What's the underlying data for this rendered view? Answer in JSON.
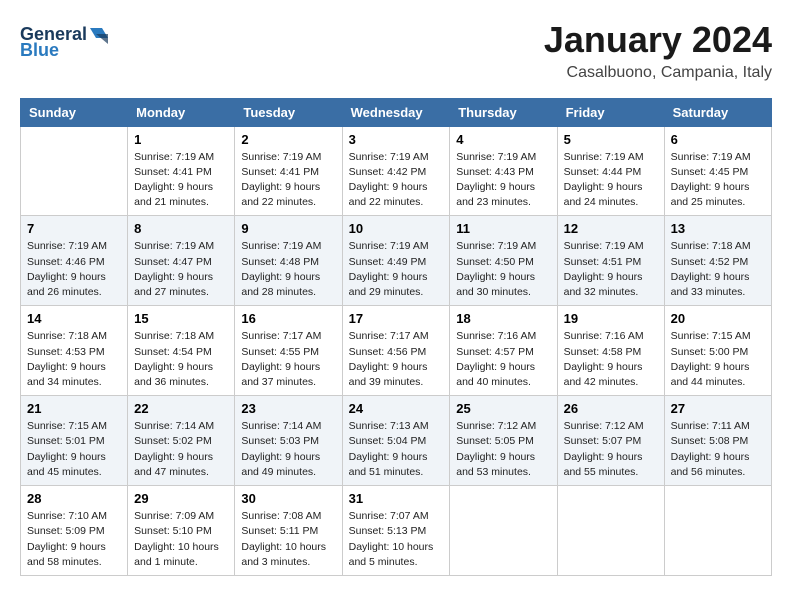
{
  "header": {
    "logo_line1": "General",
    "logo_line2": "Blue",
    "month_title": "January 2024",
    "location": "Casalbuono, Campania, Italy"
  },
  "days_of_week": [
    "Sunday",
    "Monday",
    "Tuesday",
    "Wednesday",
    "Thursday",
    "Friday",
    "Saturday"
  ],
  "weeks": [
    [
      {
        "day": "",
        "info": ""
      },
      {
        "day": "1",
        "info": "Sunrise: 7:19 AM\nSunset: 4:41 PM\nDaylight: 9 hours\nand 21 minutes."
      },
      {
        "day": "2",
        "info": "Sunrise: 7:19 AM\nSunset: 4:41 PM\nDaylight: 9 hours\nand 22 minutes."
      },
      {
        "day": "3",
        "info": "Sunrise: 7:19 AM\nSunset: 4:42 PM\nDaylight: 9 hours\nand 22 minutes."
      },
      {
        "day": "4",
        "info": "Sunrise: 7:19 AM\nSunset: 4:43 PM\nDaylight: 9 hours\nand 23 minutes."
      },
      {
        "day": "5",
        "info": "Sunrise: 7:19 AM\nSunset: 4:44 PM\nDaylight: 9 hours\nand 24 minutes."
      },
      {
        "day": "6",
        "info": "Sunrise: 7:19 AM\nSunset: 4:45 PM\nDaylight: 9 hours\nand 25 minutes."
      }
    ],
    [
      {
        "day": "7",
        "info": "Sunrise: 7:19 AM\nSunset: 4:46 PM\nDaylight: 9 hours\nand 26 minutes."
      },
      {
        "day": "8",
        "info": "Sunrise: 7:19 AM\nSunset: 4:47 PM\nDaylight: 9 hours\nand 27 minutes."
      },
      {
        "day": "9",
        "info": "Sunrise: 7:19 AM\nSunset: 4:48 PM\nDaylight: 9 hours\nand 28 minutes."
      },
      {
        "day": "10",
        "info": "Sunrise: 7:19 AM\nSunset: 4:49 PM\nDaylight: 9 hours\nand 29 minutes."
      },
      {
        "day": "11",
        "info": "Sunrise: 7:19 AM\nSunset: 4:50 PM\nDaylight: 9 hours\nand 30 minutes."
      },
      {
        "day": "12",
        "info": "Sunrise: 7:19 AM\nSunset: 4:51 PM\nDaylight: 9 hours\nand 32 minutes."
      },
      {
        "day": "13",
        "info": "Sunrise: 7:18 AM\nSunset: 4:52 PM\nDaylight: 9 hours\nand 33 minutes."
      }
    ],
    [
      {
        "day": "14",
        "info": "Sunrise: 7:18 AM\nSunset: 4:53 PM\nDaylight: 9 hours\nand 34 minutes."
      },
      {
        "day": "15",
        "info": "Sunrise: 7:18 AM\nSunset: 4:54 PM\nDaylight: 9 hours\nand 36 minutes."
      },
      {
        "day": "16",
        "info": "Sunrise: 7:17 AM\nSunset: 4:55 PM\nDaylight: 9 hours\nand 37 minutes."
      },
      {
        "day": "17",
        "info": "Sunrise: 7:17 AM\nSunset: 4:56 PM\nDaylight: 9 hours\nand 39 minutes."
      },
      {
        "day": "18",
        "info": "Sunrise: 7:16 AM\nSunset: 4:57 PM\nDaylight: 9 hours\nand 40 minutes."
      },
      {
        "day": "19",
        "info": "Sunrise: 7:16 AM\nSunset: 4:58 PM\nDaylight: 9 hours\nand 42 minutes."
      },
      {
        "day": "20",
        "info": "Sunrise: 7:15 AM\nSunset: 5:00 PM\nDaylight: 9 hours\nand 44 minutes."
      }
    ],
    [
      {
        "day": "21",
        "info": "Sunrise: 7:15 AM\nSunset: 5:01 PM\nDaylight: 9 hours\nand 45 minutes."
      },
      {
        "day": "22",
        "info": "Sunrise: 7:14 AM\nSunset: 5:02 PM\nDaylight: 9 hours\nand 47 minutes."
      },
      {
        "day": "23",
        "info": "Sunrise: 7:14 AM\nSunset: 5:03 PM\nDaylight: 9 hours\nand 49 minutes."
      },
      {
        "day": "24",
        "info": "Sunrise: 7:13 AM\nSunset: 5:04 PM\nDaylight: 9 hours\nand 51 minutes."
      },
      {
        "day": "25",
        "info": "Sunrise: 7:12 AM\nSunset: 5:05 PM\nDaylight: 9 hours\nand 53 minutes."
      },
      {
        "day": "26",
        "info": "Sunrise: 7:12 AM\nSunset: 5:07 PM\nDaylight: 9 hours\nand 55 minutes."
      },
      {
        "day": "27",
        "info": "Sunrise: 7:11 AM\nSunset: 5:08 PM\nDaylight: 9 hours\nand 56 minutes."
      }
    ],
    [
      {
        "day": "28",
        "info": "Sunrise: 7:10 AM\nSunset: 5:09 PM\nDaylight: 9 hours\nand 58 minutes."
      },
      {
        "day": "29",
        "info": "Sunrise: 7:09 AM\nSunset: 5:10 PM\nDaylight: 10 hours\nand 1 minute."
      },
      {
        "day": "30",
        "info": "Sunrise: 7:08 AM\nSunset: 5:11 PM\nDaylight: 10 hours\nand 3 minutes."
      },
      {
        "day": "31",
        "info": "Sunrise: 7:07 AM\nSunset: 5:13 PM\nDaylight: 10 hours\nand 5 minutes."
      },
      {
        "day": "",
        "info": ""
      },
      {
        "day": "",
        "info": ""
      },
      {
        "day": "",
        "info": ""
      }
    ]
  ]
}
